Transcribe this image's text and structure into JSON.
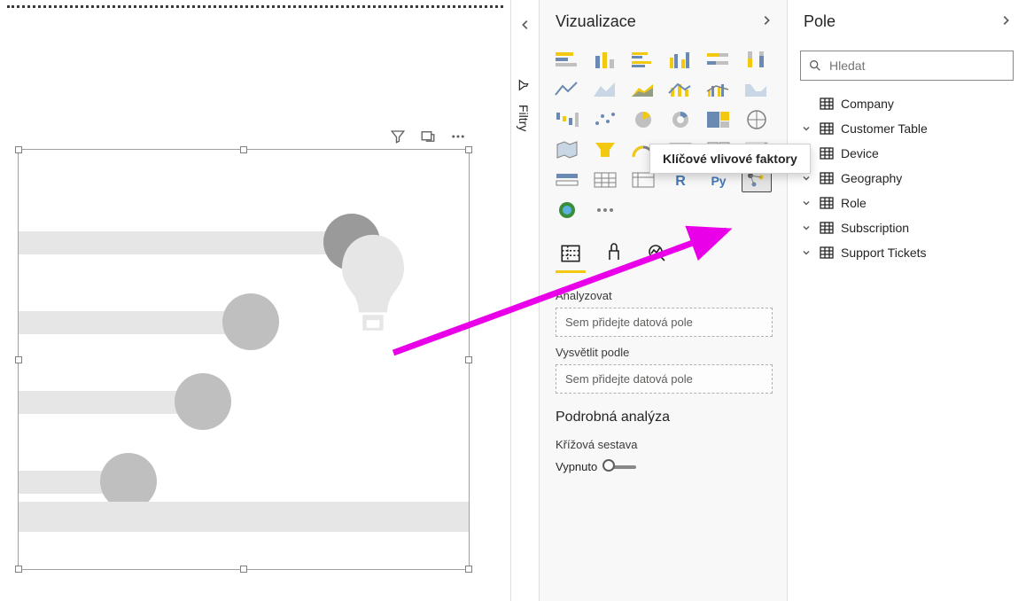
{
  "panels": {
    "viz_title": "Vizualizace",
    "fields_title": "Pole",
    "filters_title": "Filtry"
  },
  "search": {
    "placeholder": "Hledat"
  },
  "fieldWells": {
    "analyze_label": "Analyzovat",
    "analyze_placeholder": "Sem přidejte datová pole",
    "explain_label": "Vysvětlit podle",
    "explain_placeholder": "Sem přidejte datová pole"
  },
  "drill": {
    "heading": "Podrobná analýza",
    "cross_label": "Křížová sestava",
    "toggle_state": "Vypnuto"
  },
  "tooltip": "Klíčové vlivové faktory",
  "tables": [
    {
      "name": "Company",
      "expandable": false
    },
    {
      "name": "Customer Table",
      "expandable": true
    },
    {
      "name": "Device",
      "expandable": true
    },
    {
      "name": "Geography",
      "expandable": true
    },
    {
      "name": "Role",
      "expandable": true
    },
    {
      "name": "Subscription",
      "expandable": true
    },
    {
      "name": "Support Tickets",
      "expandable": true
    }
  ],
  "colors": {
    "accent": "#F2C811",
    "annotation": "#E900E9"
  }
}
